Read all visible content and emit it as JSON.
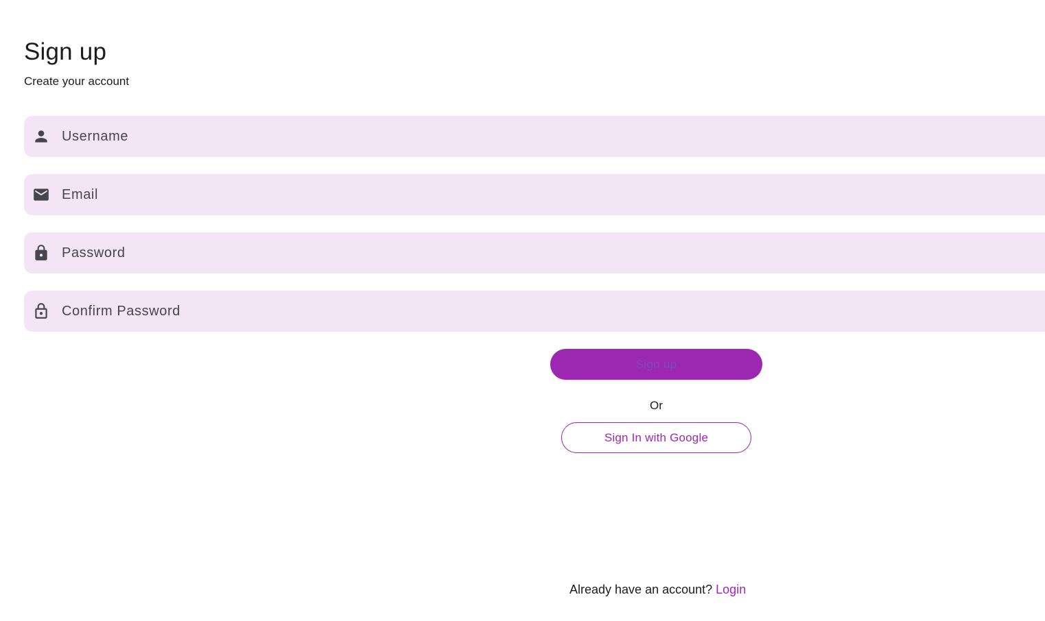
{
  "header": {
    "title": "Sign up",
    "subtitle": "Create your account"
  },
  "form": {
    "username": {
      "placeholder": "Username",
      "value": "",
      "icon": "person-icon"
    },
    "email": {
      "placeholder": "Email",
      "value": "",
      "icon": "mail-icon"
    },
    "password": {
      "placeholder": "Password",
      "value": "",
      "icon": "lock-icon"
    },
    "confirm_password": {
      "placeholder": "Confirm Password",
      "value": "",
      "icon": "lock-open-icon"
    }
  },
  "actions": {
    "signup_label": "Sign up",
    "or_label": "Or",
    "google_label": "Sign In with Google"
  },
  "footer": {
    "prompt": "Already have an account?",
    "login_label": "Login"
  },
  "colors": {
    "accent": "#9c27b0",
    "field_bg": "#f3e5f5",
    "text": "#1d1b20",
    "icon": "#49454f"
  }
}
